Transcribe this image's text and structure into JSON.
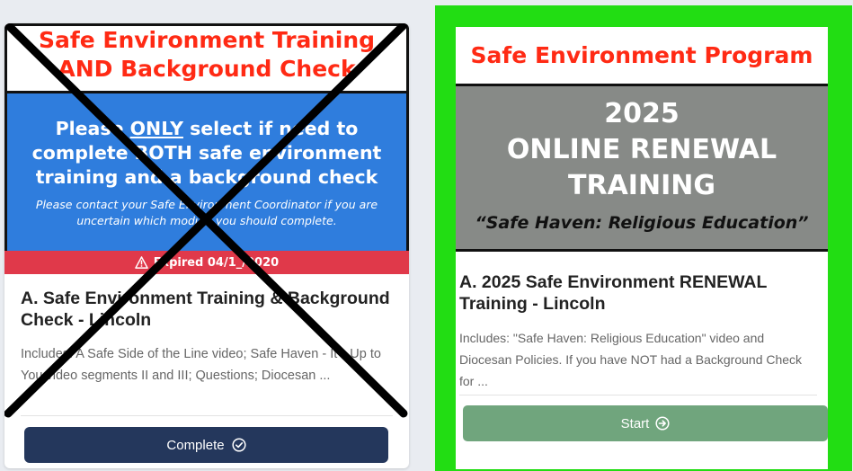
{
  "left_card": {
    "banner": {
      "title_line1": "Safe Environment Training",
      "title_line2": "AND Background Check",
      "main_pre": "Please ",
      "main_emph": "ONLY",
      "main_post": " select if need to",
      "main_line2": "complete BOTH safe environment",
      "main_line3": "training and a background check",
      "note_line1": "Please contact your Safe Environment Coordinator if you are",
      "note_line2": "uncertain which module you should complete."
    },
    "status_badge": "Expired 04/1_/2020",
    "course_title": "A. Safe Environment Training & Background Check - Lincoln",
    "course_desc": "Includes: A Safe Side of the Line video; Safe Haven - It's Up to You video segments II and III; Questions; Diocesan ...",
    "button_label": "Complete",
    "crossed_out": true
  },
  "right_card": {
    "highlight_color": "#22dd13",
    "banner": {
      "title": "Safe Environment Program",
      "big_line1": "2025",
      "big_line2": "ONLINE RENEWAL",
      "big_line3": "TRAINING",
      "subtitle": "“Safe Haven: Religious Education”"
    },
    "course_title": "A. 2025 Safe Environment RENEWAL Training - Lincoln",
    "course_desc": "Includes: \"Safe Haven: Religious Education\" video and Diocesan Policies. If you have NOT had a Background Check for ...",
    "button_label": "Start"
  },
  "icons": {
    "expired": "warning-triangle-icon",
    "complete": "check-circle-icon",
    "start": "arrow-right-circle-icon"
  }
}
